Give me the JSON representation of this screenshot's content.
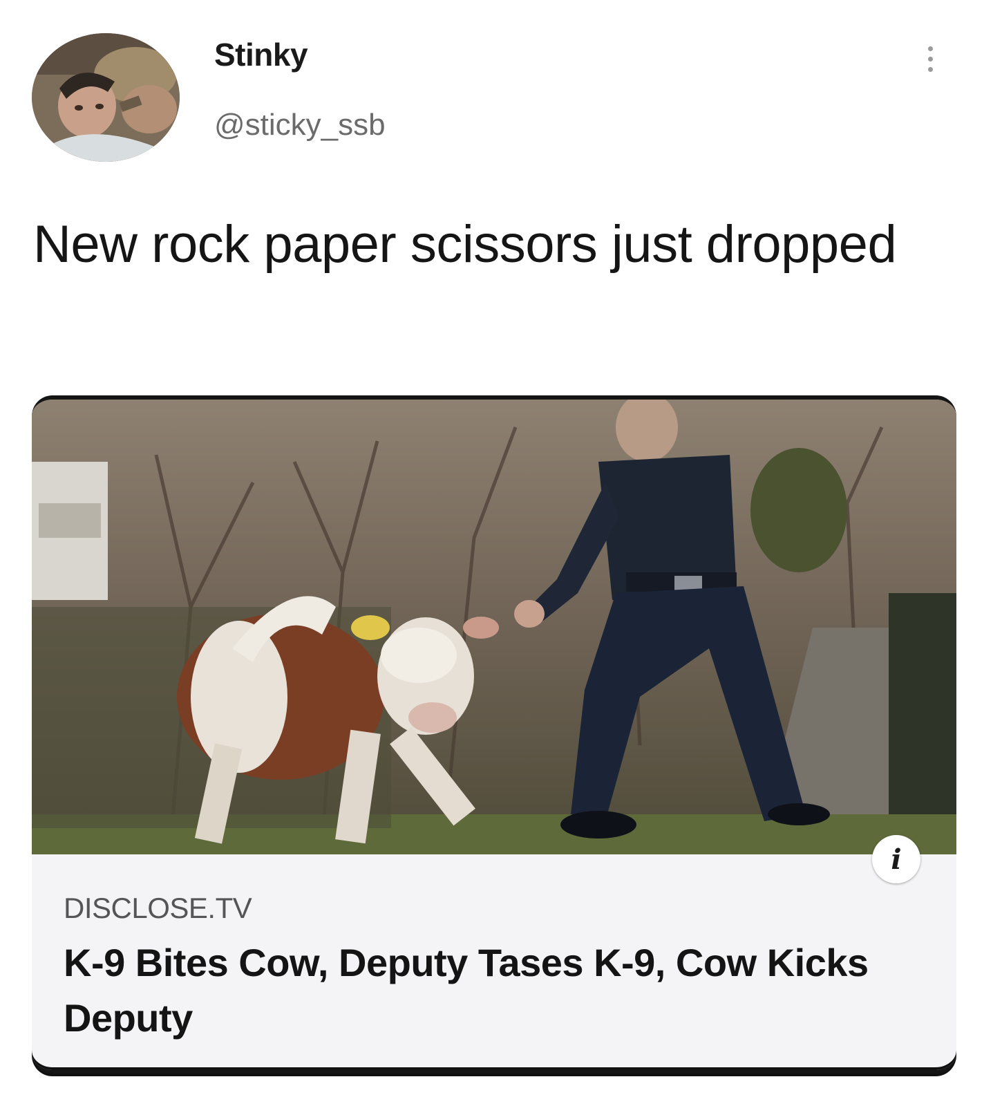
{
  "post": {
    "display_name": "Stinky",
    "handle": "@sticky_ssb",
    "text": "New rock paper scissors just dropped",
    "avatar_icon": "profile-photo",
    "more_icon": "vertical-ellipsis-icon"
  },
  "link_card": {
    "source": "DISCLOSE.TV",
    "title": "K-9 Bites Cow, Deputy Tases K-9, Cow Kicks Deputy",
    "info_label": "i",
    "image_description_icon": "cow-and-police-officer-photo"
  },
  "colors": {
    "background": "#ffffff",
    "text_primary": "#151515",
    "text_secondary": "#6b6b6b",
    "card_background": "#f4f4f6"
  }
}
